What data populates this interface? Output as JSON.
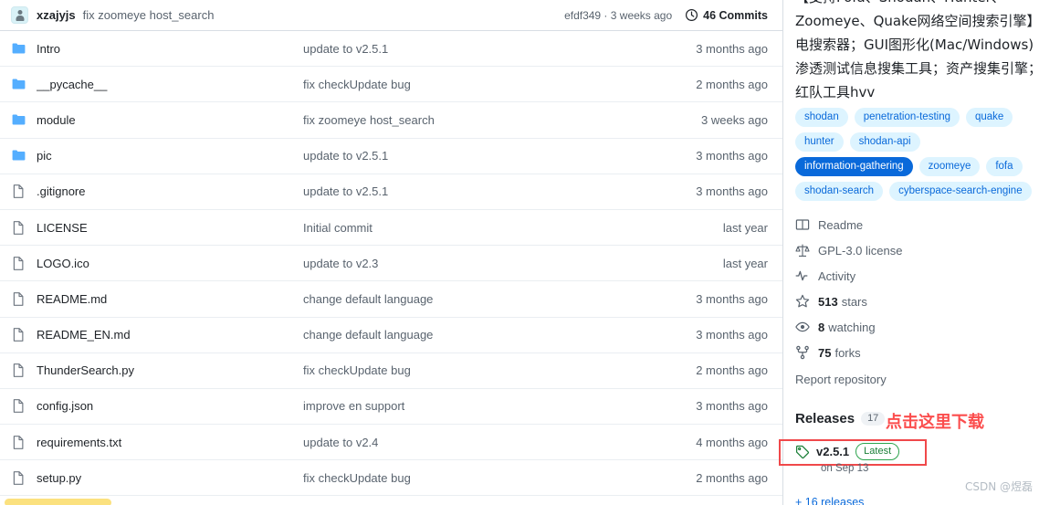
{
  "commit_bar": {
    "author": "xzajyjs",
    "message": "fix zoomeye host_search",
    "sha": "efdf349",
    "sha_age": "efdf349 · 3 weeks ago",
    "commits_label": "46 Commits",
    "clock_icon": "clock-icon",
    "avatar_icon": "avatar-icon"
  },
  "files": {
    "rows": [
      {
        "icon": "folder-icon",
        "type": "folder",
        "name": "Intro",
        "message": "update to v2.5.1",
        "age": "3 months ago"
      },
      {
        "icon": "folder-icon",
        "type": "folder",
        "name": "__pycache__",
        "message": "fix checkUpdate bug",
        "age": "2 months ago"
      },
      {
        "icon": "folder-icon",
        "type": "folder",
        "name": "module",
        "message": "fix zoomeye host_search",
        "age": "3 weeks ago"
      },
      {
        "icon": "folder-icon",
        "type": "folder",
        "name": "pic",
        "message": "update to v2.5.1",
        "age": "3 months ago"
      },
      {
        "icon": "file-icon",
        "type": "file",
        "name": ".gitignore",
        "message": "update to v2.5.1",
        "age": "3 months ago"
      },
      {
        "icon": "file-icon",
        "type": "file",
        "name": "LICENSE",
        "message": "Initial commit",
        "age": "last year"
      },
      {
        "icon": "file-icon",
        "type": "file",
        "name": "LOGO.ico",
        "message": "update to v2.3",
        "age": "last year"
      },
      {
        "icon": "file-icon",
        "type": "file",
        "name": "README.md",
        "message": "change default language",
        "age": "3 months ago"
      },
      {
        "icon": "file-icon",
        "type": "file",
        "name": "README_EN.md",
        "message": "change default language",
        "age": "3 months ago"
      },
      {
        "icon": "file-icon",
        "type": "file",
        "name": "ThunderSearch.py",
        "message": "fix checkUpdate bug",
        "age": "2 months ago"
      },
      {
        "icon": "file-icon",
        "type": "file",
        "name": "config.json",
        "message": "improve en support",
        "age": "3 months ago"
      },
      {
        "icon": "file-icon",
        "type": "file",
        "name": "requirements.txt",
        "message": "update to v2.4",
        "age": "4 months ago"
      },
      {
        "icon": "file-icon",
        "type": "file",
        "name": "setup.py",
        "message": "fix checkUpdate bug",
        "age": "2 months ago"
      }
    ]
  },
  "sidebar": {
    "description": "【支持Fofa、Shodan、Hunter、Zoomeye、Quake网络空间搜索引擎】电搜索器；GUI图形化(Mac/Windows)渗透测试信息搜集工具；资产搜集引擎；红队工具hvv",
    "topics": [
      {
        "label": "shodan",
        "active": false
      },
      {
        "label": "penetration-testing",
        "active": false
      },
      {
        "label": "quake",
        "active": false
      },
      {
        "label": "hunter",
        "active": false
      },
      {
        "label": "shodan-api",
        "active": false
      },
      {
        "label": "information-gathering",
        "active": true
      },
      {
        "label": "zoomeye",
        "active": false
      },
      {
        "label": "fofa",
        "active": false
      },
      {
        "label": "shodan-search",
        "active": false
      },
      {
        "label": "cyberspace-search-engine",
        "active": false
      }
    ],
    "links": [
      {
        "icon": "book-icon",
        "label": "Readme"
      },
      {
        "icon": "scale-icon",
        "label": "GPL-3.0 license"
      },
      {
        "icon": "activity-icon",
        "label": "Activity"
      },
      {
        "icon": "star-icon",
        "count": "513",
        "label": "stars"
      },
      {
        "icon": "eye-icon",
        "count": "8",
        "label": "watching"
      },
      {
        "icon": "fork-icon",
        "count": "75",
        "label": "forks"
      }
    ],
    "report_label": "Report repository",
    "releases": {
      "title": "Releases",
      "count": "17",
      "tag_icon": "tag-icon",
      "version": "v2.5.1",
      "latest_label": "Latest",
      "date": "on Sep 13",
      "more_label": "+ 16 releases"
    },
    "annotation": "点击这里下载"
  },
  "watermark": "CSDN @煜磊",
  "colors": {
    "accent_blue": "#0969da",
    "topic_bg": "#ddf4ff",
    "folder_blue": "#54aeff",
    "annotation_red": "#fb4d4d",
    "box_red": "#f0484a",
    "green": "#1a7f37",
    "highlight_yellow": "#fbe17f"
  }
}
